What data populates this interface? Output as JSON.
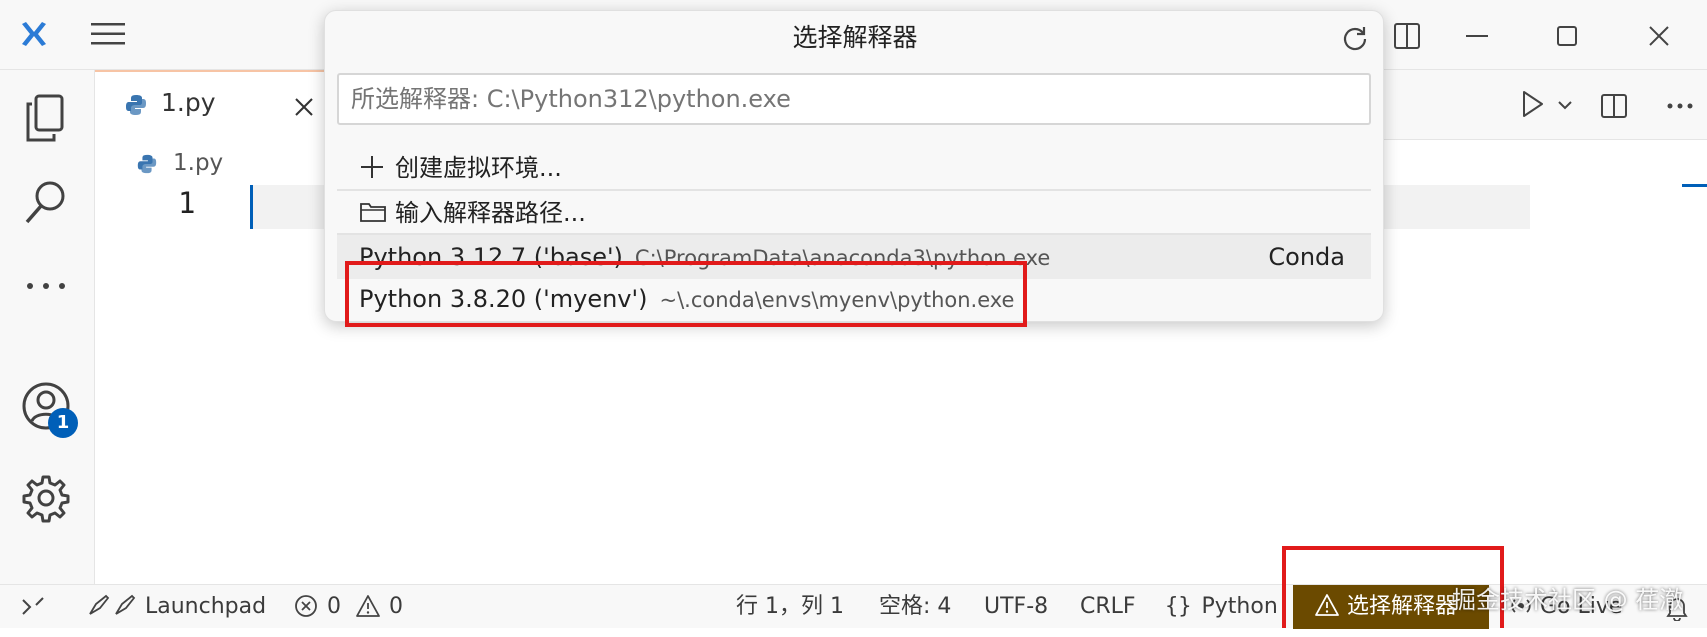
{
  "tab": {
    "filename": "1.py"
  },
  "breadcrumb": {
    "file": "1.py"
  },
  "editor": {
    "line_number": "1"
  },
  "activity": {
    "account_badge": "1"
  },
  "quickpick": {
    "title": "选择解释器",
    "placeholder": "所选解释器: C:\\Python312\\python.exe",
    "items": [
      {
        "label": "创建虚拟环境..."
      },
      {
        "label": "输入解释器路径..."
      },
      {
        "label": "Python 3.12.7 ('base')",
        "description": "C:\\ProgramData\\anaconda3\\python.exe",
        "detail": "Conda"
      },
      {
        "label": "Python 3.8.20 ('myenv')",
        "description": "~\\.conda\\envs\\myenv\\python.exe"
      }
    ]
  },
  "statusbar": {
    "launchpad": "Launchpad",
    "errors": "0",
    "warnings": "0",
    "cursor": "行 1，列 1",
    "spaces": "空格: 4",
    "encoding": "UTF-8",
    "eol": "CRLF",
    "language": "Python",
    "select_interpreter": "选择解释器",
    "golive": "Go Live"
  },
  "watermark": "掘金技术社区 @ 荏澈",
  "colors": {
    "accent": "#005fb8",
    "warning_bg": "#6b4a00",
    "highlight": "#e11a1a"
  }
}
